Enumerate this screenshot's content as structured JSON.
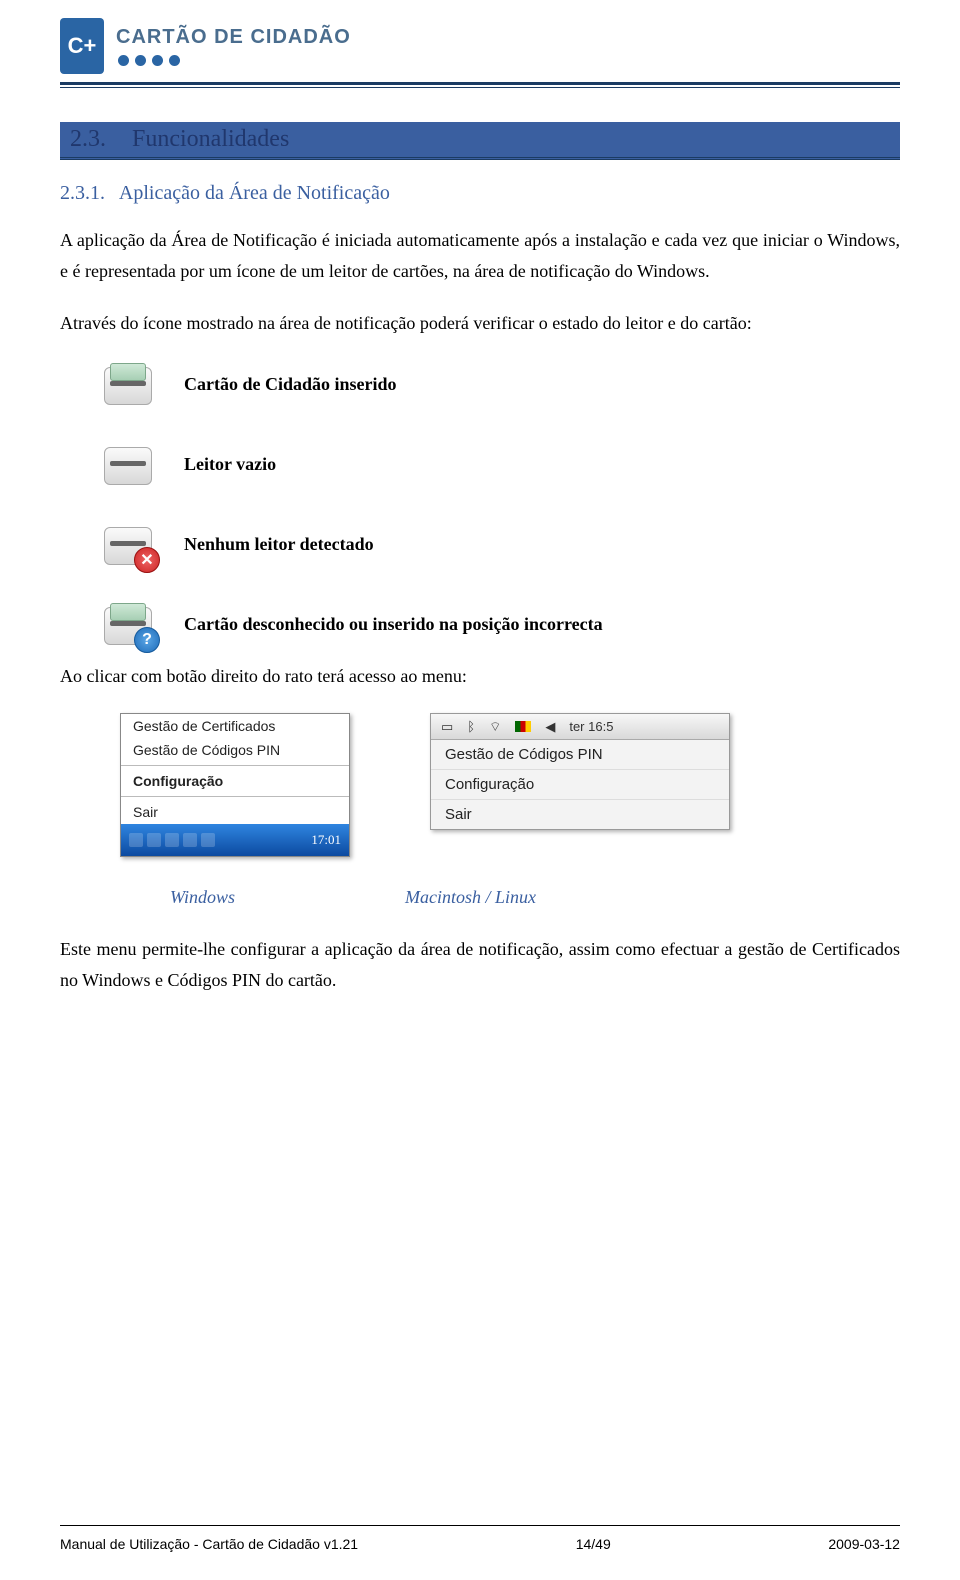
{
  "header": {
    "brand": "CARTÃO DE CIDADÃO"
  },
  "section": {
    "number": "2.3.",
    "title": "Funcionalidades"
  },
  "subsection": {
    "number": "2.3.1.",
    "title": "Aplicação da Área de Notificação"
  },
  "paragraphs": {
    "p1": "A aplicação da Área de Notificação é iniciada automaticamente após a instalação e cada vez que iniciar o Windows, e é representada por um ícone de um leitor de cartões, na área de notificação do Windows.",
    "p2": "Através do ícone mostrado na área de notificação poderá verificar o estado do leitor e do cartão:",
    "p3": "Ao clicar com botão direito do rato terá acesso ao menu:",
    "p4": "Este menu permite-lhe configurar a aplicação da área de notificação, assim como efectuar a gestão de Certificados no Windows e Códigos PIN do cartão."
  },
  "statuses": {
    "inserted": "Cartão de Cidadão inserido",
    "empty": "Leitor vazio",
    "none": "Nenhum leitor detectado",
    "unknown": "Cartão desconhecido ou inserido na posição incorrecta"
  },
  "windows_menu": {
    "cert": "Gestão de Certificados",
    "pin": "Gestão de Códigos PIN",
    "config": "Configuração",
    "exit": "Sair",
    "clock": "17:01"
  },
  "mac_menu": {
    "bar_time": "ter 16:5",
    "pin": "Gestão de Códigos PIN",
    "config": "Configuração",
    "exit": "Sair"
  },
  "os_labels": {
    "win": "Windows",
    "mac": "Macintosh / Linux"
  },
  "footer": {
    "doc_title": "Manual de Utilização - Cartão de Cidadão v1.21",
    "page_current": "14",
    "page_total": "49",
    "date": "2009-03-12"
  }
}
